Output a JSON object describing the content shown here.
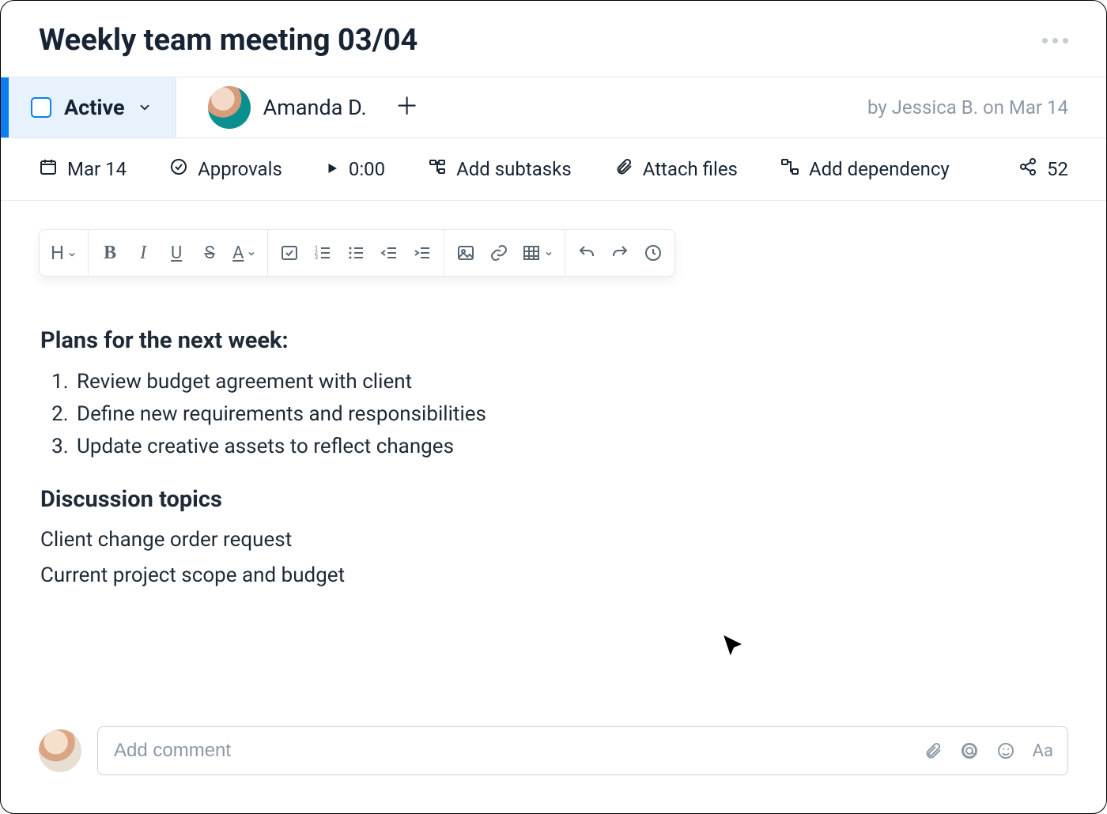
{
  "header": {
    "title": "Weekly team meeting 03/04"
  },
  "status": {
    "label": "Active"
  },
  "assignee": {
    "name": "Amanda D."
  },
  "byline": "by Jessica B. on Mar 14",
  "meta": {
    "date": "Mar 14",
    "approvals": "Approvals",
    "timer": "0:00",
    "add_subtasks": "Add subtasks",
    "attach_files": "Attach files",
    "add_dependency": "Add dependency",
    "share_count": "52"
  },
  "toolbar": {
    "heading": "H",
    "bold": "B",
    "italic": "I",
    "underline": "U",
    "strike": "S",
    "textcolor": "A"
  },
  "doc": {
    "h1": "Plans for the next week:",
    "list": [
      "Review budget agreement with client",
      "Define new requirements and responsibilities",
      "Update creative assets to reflect changes"
    ],
    "h2": "Discussion topics",
    "paras": [
      "Client change order request",
      "Current project scope and budget"
    ]
  },
  "comment": {
    "placeholder": "Add comment",
    "aa": "Aa"
  }
}
